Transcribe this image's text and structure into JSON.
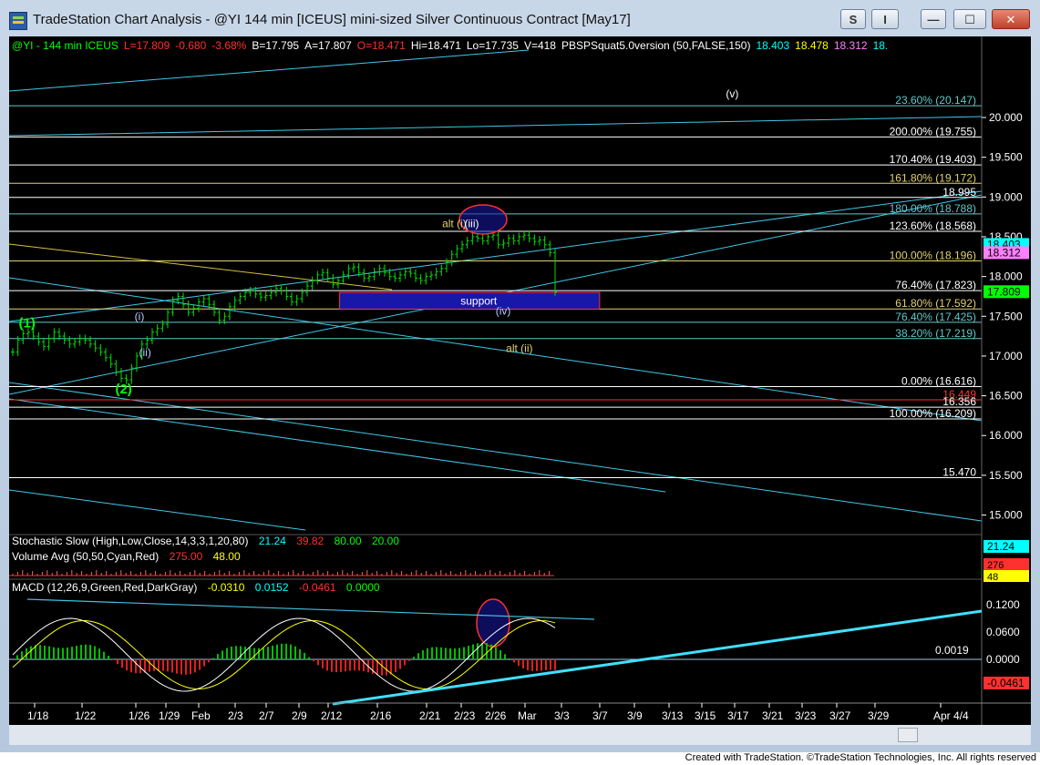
{
  "window": {
    "title": "TradeStation Chart Analysis - @YI 144 min [ICEUS] mini-sized Silver Continuous Contract [May17]",
    "buttons": {
      "s_label": "S",
      "i_label": "I",
      "minimize_label": "—",
      "maximize_label": "☐",
      "close_label": "✕"
    }
  },
  "status_line": [
    {
      "text": "@YI - 144 min  ICEUS",
      "color": "#00ff00"
    },
    {
      "text": "L=17.809",
      "color": "#ff3030"
    },
    {
      "text": "-0.680",
      "color": "#ff3030"
    },
    {
      "text": "-3.68%",
      "color": "#ff3030"
    },
    {
      "text": "B=17.795",
      "color": "#ffffff"
    },
    {
      "text": "A=17.807",
      "color": "#ffffff"
    },
    {
      "text": "O=18.471",
      "color": "#ff3030"
    },
    {
      "text": "Hi=18.471",
      "color": "#ffffff"
    },
    {
      "text": "Lo=17.735",
      "color": "#ffffff"
    },
    {
      "text": "V=418",
      "color": "#ffffff"
    },
    {
      "text": "PBSPSquat5.0version (50,FALSE,150)",
      "color": "#ffffff"
    },
    {
      "text": "18.403",
      "color": "#00ffff"
    },
    {
      "text": "18.478",
      "color": "#ffff00"
    },
    {
      "text": "18.312",
      "color": "#ff80ff"
    },
    {
      "text": "18.",
      "color": "#00ffff"
    }
  ],
  "price_axis": {
    "ticks": [
      "20.000",
      "19.500",
      "19.000",
      "18.500",
      "18.000",
      "17.500",
      "17.000",
      "16.500",
      "16.000",
      "15.500",
      "15.000"
    ],
    "last_price_tags": [
      {
        "text": "18.403",
        "bg": "#00ffff",
        "fg": "#000000",
        "value": 18.403
      },
      {
        "text": "18.312",
        "bg": "#ff80ff",
        "fg": "#000000",
        "value": 18.3
      },
      {
        "text": "17.809",
        "bg": "#00ff00",
        "fg": "#000000",
        "value": 17.809
      }
    ]
  },
  "fib_levels": [
    {
      "label": "23.60% (20.147)",
      "value": 20.147,
      "color": "#5fc8c8"
    },
    {
      "label": "200.00% (19.755)",
      "value": 19.755,
      "color": "#ffffff"
    },
    {
      "label": "170.40% (19.403)",
      "value": 19.403,
      "color": "#ffffff"
    },
    {
      "label": "161.80% (19.172)",
      "value": 19.172,
      "color": "#e0d070"
    },
    {
      "label": "18.995",
      "value": 18.995,
      "color": "#ffffff"
    },
    {
      "label": "180.00% (18.788)",
      "value": 18.788,
      "color": "#5fc8c8"
    },
    {
      "label": "123.60% (18.568)",
      "value": 18.568,
      "color": "#ffffff"
    },
    {
      "label": "100.00% (18.196)",
      "value": 18.196,
      "color": "#e0d070"
    },
    {
      "label": "76.40% (17.823)",
      "value": 17.823,
      "color": "#ffffff"
    },
    {
      "label": "61.80% (17.592)",
      "value": 17.592,
      "color": "#e0d070"
    },
    {
      "label": "76.40% (17.425)",
      "value": 17.425,
      "color": "#5fc8c8"
    },
    {
      "label": "38.20% (17.219)",
      "value": 17.219,
      "color": "#5fc8c8"
    },
    {
      "label": "0.00% (16.616)",
      "value": 16.616,
      "color": "#ffffff"
    },
    {
      "label": "16.449",
      "value": 16.449,
      "color": "#ff3030"
    },
    {
      "label": "16.356",
      "value": 16.356,
      "color": "#ffffff"
    },
    {
      "label": "100.00% (16.209)",
      "value": 16.209,
      "color": "#ffffff"
    },
    {
      "label": "15.470",
      "value": 15.47,
      "color": "#ffffff"
    }
  ],
  "wave_labels": [
    {
      "text": "(1)",
      "color": "#00ff00",
      "date_index": 0.4,
      "price": 17.36
    },
    {
      "text": "(2)",
      "color": "#00ff00",
      "date_index": 6.9,
      "price": 16.53
    },
    {
      "text": "(i)",
      "color": "#b8c8ff",
      "date_index": 8.2,
      "price": 17.45
    },
    {
      "text": "(ii)",
      "color": "#b8c8ff",
      "date_index": 8.5,
      "price": 17.0
    },
    {
      "text": "alt (i)",
      "color": "#e0d070",
      "date_index": 28.9,
      "price": 18.62
    },
    {
      "text": "(iii)",
      "color": "#ffffff",
      "date_index": 30.4,
      "price": 18.62
    },
    {
      "text": "(iv)",
      "color": "#b8c8ff",
      "date_index": 32.5,
      "price": 17.52
    },
    {
      "text": "alt (ii)",
      "color": "#e0d070",
      "date_index": 33.2,
      "price": 17.05
    },
    {
      "text": "(v)",
      "color": "#ffffff",
      "date_index": 48.0,
      "price": 20.25
    }
  ],
  "support_box": {
    "label": "support",
    "price_top": 17.8,
    "price_bottom": 17.59,
    "date_from": 22.0,
    "date_to": 39.5
  },
  "indicators": {
    "stochastic": {
      "name": "Stochastic Slow (High,Low,Close,14,3,3,1,20,80)",
      "v1": "21.24",
      "v2": "39.82",
      "v3": "80.00",
      "v4": "20.00",
      "tag": "21.24"
    },
    "volume": {
      "name": "Volume Avg (50,50,Cyan,Red)",
      "v1": "275.00",
      "v2": "48.00",
      "tags": [
        "276",
        "48"
      ]
    },
    "macd": {
      "name": "MACD (12,26,9,Green,Red,DarkGray)",
      "v1": "-0.0310",
      "v2": "0.0152",
      "v3": "-0.0461",
      "v4": "0.0000",
      "ticks": [
        "0.1200",
        "0.0600",
        "0.0000"
      ],
      "readout": "0.0019",
      "tag": "-0.0461"
    }
  },
  "date_axis": [
    "1/18",
    "1/22",
    "1/26",
    "1/29",
    "Feb",
    "2/3",
    "2/7",
    "2/9",
    "2/12",
    "2/16",
    "2/21",
    "2/23",
    "2/26",
    "Mar",
    "3/3",
    "3/7",
    "3/9",
    "3/13",
    "3/15",
    "3/17",
    "3/21",
    "3/23",
    "3/27",
    "3/29",
    "Apr 4/4"
  ],
  "footer": "Created with TradeStation. ©TradeStation Technologies, Inc. All rights reserved",
  "chart_data": {
    "type": "candlestick",
    "price_range": [
      14.8,
      20.55
    ],
    "bars": [
      17.05,
      17.2,
      17.28,
      17.3,
      17.25,
      17.18,
      17.12,
      17.22,
      17.3,
      17.25,
      17.2,
      17.15,
      17.18,
      17.22,
      17.2,
      17.15,
      17.1,
      17.05,
      16.98,
      16.9,
      16.8,
      16.72,
      16.7,
      16.85,
      17.0,
      17.15,
      17.2,
      17.3,
      17.35,
      17.4,
      17.55,
      17.7,
      17.75,
      17.65,
      17.55,
      17.6,
      17.68,
      17.72,
      17.65,
      17.55,
      17.45,
      17.5,
      17.62,
      17.7,
      17.75,
      17.8,
      17.82,
      17.78,
      17.74,
      17.76,
      17.8,
      17.85,
      17.82,
      17.75,
      17.68,
      17.72,
      17.8,
      17.88,
      17.95,
      18.02,
      18.05,
      17.98,
      17.9,
      17.95,
      18.02,
      18.1,
      18.12,
      18.05,
      17.98,
      18.0,
      18.06,
      18.1,
      18.05,
      18.0,
      17.98,
      18.02,
      18.06,
      18.04,
      17.98,
      17.95,
      18.0,
      18.02,
      18.06,
      18.1,
      18.18,
      18.28,
      18.35,
      18.4,
      18.45,
      18.5,
      18.48,
      18.45,
      18.5,
      18.52,
      18.4,
      18.42,
      18.48,
      18.45,
      18.5,
      18.52,
      18.48,
      18.44,
      18.46,
      18.4,
      18.3,
      17.81
    ]
  }
}
